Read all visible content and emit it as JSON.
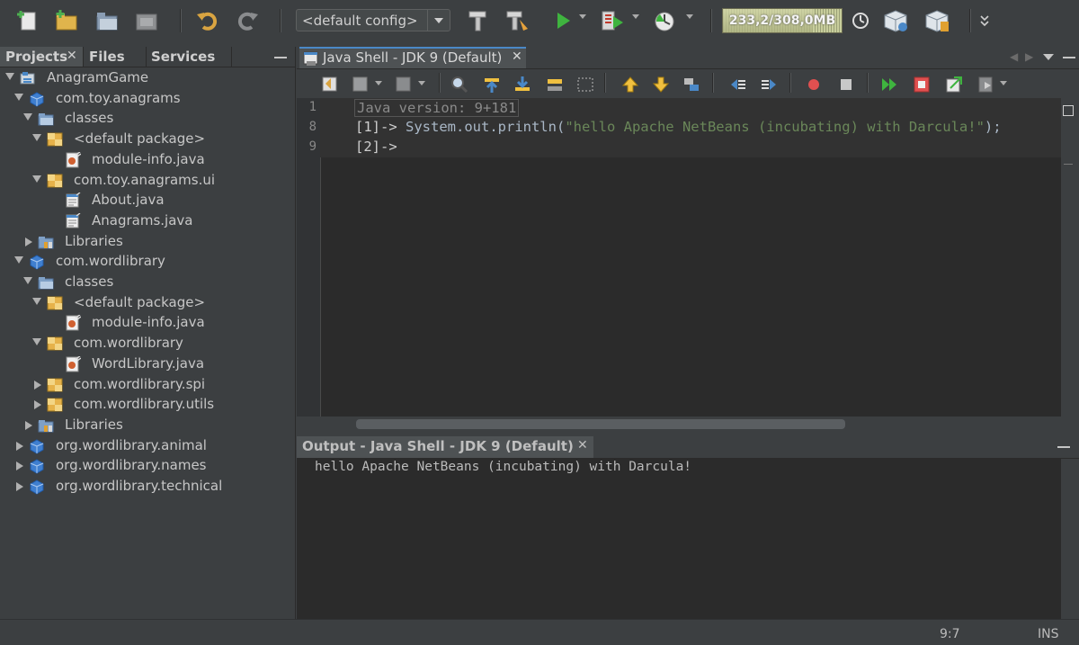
{
  "toolbar": {
    "config_value": "<default config>",
    "memory": {
      "label": "233,2/308,0MB",
      "used_fraction": 0.757
    }
  },
  "left_tabs": [
    {
      "label": "Projects",
      "close": "✕"
    },
    {
      "label": "Files"
    },
    {
      "label": "Services"
    }
  ],
  "tree": [
    {
      "label": "AnagramGame",
      "depth": 0,
      "expander": "open",
      "icon": "project-icon"
    },
    {
      "label": "com.toy.anagrams",
      "depth": 1,
      "expander": "open",
      "icon": "module-icon"
    },
    {
      "label": "classes",
      "depth": 2,
      "expander": "open",
      "icon": "folder-icon"
    },
    {
      "label": "<default package>",
      "depth": 3,
      "expander": "open",
      "icon": "package-icon"
    },
    {
      "label": "module-info.java",
      "depth": 4,
      "expander": "none",
      "icon": "java-file-icon"
    },
    {
      "label": "com.toy.anagrams.ui",
      "depth": 3,
      "expander": "open",
      "icon": "package-icon"
    },
    {
      "label": "About.java",
      "depth": 4,
      "expander": "none",
      "icon": "java-form-icon"
    },
    {
      "label": "Anagrams.java",
      "depth": 4,
      "expander": "none",
      "icon": "java-form-icon"
    },
    {
      "label": "Libraries",
      "depth": 2,
      "expander": "closed",
      "icon": "libraries-icon"
    },
    {
      "label": "com.wordlibrary",
      "depth": 1,
      "expander": "open",
      "icon": "module-icon"
    },
    {
      "label": "classes",
      "depth": 2,
      "expander": "open",
      "icon": "folder-icon"
    },
    {
      "label": "<default package>",
      "depth": 3,
      "expander": "open",
      "icon": "package-icon"
    },
    {
      "label": "module-info.java",
      "depth": 4,
      "expander": "none",
      "icon": "java-file-icon"
    },
    {
      "label": "com.wordlibrary",
      "depth": 3,
      "expander": "open",
      "icon": "package-icon"
    },
    {
      "label": "WordLibrary.java",
      "depth": 4,
      "expander": "none",
      "icon": "java-file-icon"
    },
    {
      "label": "com.wordlibrary.spi",
      "depth": 3,
      "expander": "closed",
      "icon": "package-icon"
    },
    {
      "label": "com.wordlibrary.utils",
      "depth": 3,
      "expander": "closed",
      "icon": "package-icon"
    },
    {
      "label": "Libraries",
      "depth": 2,
      "expander": "closed",
      "icon": "libraries-icon"
    },
    {
      "label": "org.wordlibrary.animal",
      "depth": 1,
      "expander": "closed",
      "icon": "module-icon"
    },
    {
      "label": "org.wordlibrary.names",
      "depth": 1,
      "expander": "closed",
      "icon": "module-icon"
    },
    {
      "label": "org.wordlibrary.technical",
      "depth": 1,
      "expander": "closed",
      "icon": "module-icon"
    }
  ],
  "editor": {
    "tab_label": "Java Shell - JDK 9 (Default)",
    "tab_close": "✕",
    "lines": [
      {
        "num": "1",
        "prefix": "",
        "text": "Java version: 9+181",
        "kind": "folded"
      },
      {
        "num": "8",
        "prefix": "[1]->",
        "text": " System.out.println(",
        "string": "\"hello Apache NetBeans (incubating) with Darcula!\"",
        "suffix": ");",
        "kind": "code"
      },
      {
        "num": "9",
        "prefix": "[2]->",
        "text": "",
        "kind": "prompt"
      }
    ]
  },
  "output": {
    "tab_label": "Output - Java Shell - JDK 9 (Default)",
    "tab_close": "✕",
    "text": "hello Apache NetBeans (incubating) with Darcula!"
  },
  "status": {
    "position": "9:7",
    "mode": "INS"
  },
  "colors": {
    "accent": "#4a88c7",
    "string": "#6a8759",
    "code": "#a9b7c6",
    "editor_bg": "#2b2b2b"
  }
}
